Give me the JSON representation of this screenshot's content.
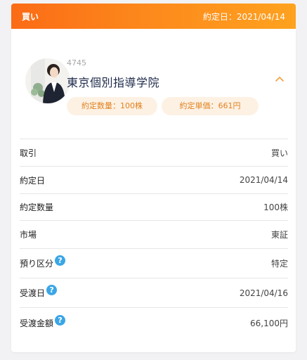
{
  "header": {
    "trade_type": "買い",
    "contract_date_label": "約定日：2021/04/14"
  },
  "stock": {
    "code": "4745",
    "name": "東京個別指導学院",
    "quantity_pill": "約定数量：100株",
    "price_pill": "約定単価：661円"
  },
  "details": [
    {
      "label": "取引",
      "value": "買い",
      "help": false
    },
    {
      "label": "約定日",
      "value": "2021/04/14",
      "help": false
    },
    {
      "label": "約定数量",
      "value": "100株",
      "help": false
    },
    {
      "label": "市場",
      "value": "東証",
      "help": false
    },
    {
      "label": "預り区分",
      "value": "特定",
      "help": true
    },
    {
      "label": "受渡日",
      "value": "2021/04/16",
      "help": true
    },
    {
      "label": "受渡金額",
      "value": "66,100円",
      "help": true
    }
  ],
  "help_glyph": "?",
  "icons": {
    "collapse": "chevron-up-icon",
    "help": "question-circle-icon"
  },
  "colors": {
    "header_gradient_start": "#fb6b16",
    "header_gradient_end": "#fea21f",
    "accent": "#e0811f",
    "pill_bg": "#fdf1e3",
    "help_icon": "#3ba6e6",
    "company_text": "#1d2a4a"
  }
}
